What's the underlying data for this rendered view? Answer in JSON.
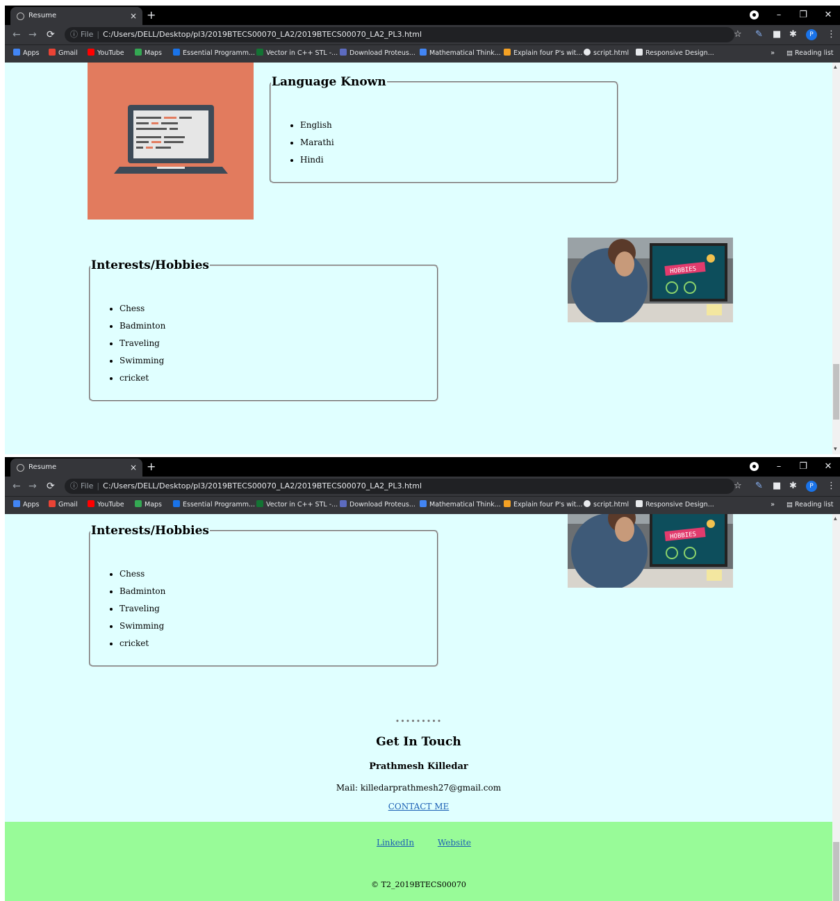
{
  "browser": {
    "tab_title": "Resume",
    "tab_close": "×",
    "new_tab": "+",
    "address_info": "ⓘ",
    "address_scheme": "File",
    "address_url": "C:/Users/DELL/Desktop/pl3/2019BTECS00070_LA2/2019BTECS00070_LA2_PL3.html",
    "avatar_letter": "P",
    "bookmarks": [
      "Apps",
      "Gmail",
      "YouTube",
      "Maps",
      "Essential Programm...",
      "Vector in C++ STL -...",
      "Download Proteus...",
      "Mathematical Think...",
      "Explain four P's wit...",
      "script.html",
      "Responsive Design..."
    ],
    "bookmarks_more": "»",
    "reading_list": "Reading list"
  },
  "page": {
    "languages": {
      "legend": "Language Known",
      "items": [
        "English",
        "Marathi",
        "Hindi"
      ]
    },
    "hobbies": {
      "legend": "Interests/Hobbies",
      "items": [
        "Chess",
        "Badminton",
        "Traveling",
        "Swimming",
        "cricket"
      ],
      "image_label": "HOBBIES"
    },
    "contact": {
      "dots": "•••••••••",
      "heading": "Get In Touch",
      "name": "Prathmesh Killedar",
      "mail": "Mail: killedarprathmesh27@gmail.com",
      "contact_link": "CONTACT ME"
    },
    "footer": {
      "linkedin": "LinkedIn",
      "website": "Website",
      "copyright": "© T2_2019BTECS00070"
    }
  },
  "colors": {
    "page_bg": "#e0ffff",
    "footer_bg": "#98fb98",
    "laptop_bg": "#e27b5e",
    "link": "#1a5fb4"
  }
}
